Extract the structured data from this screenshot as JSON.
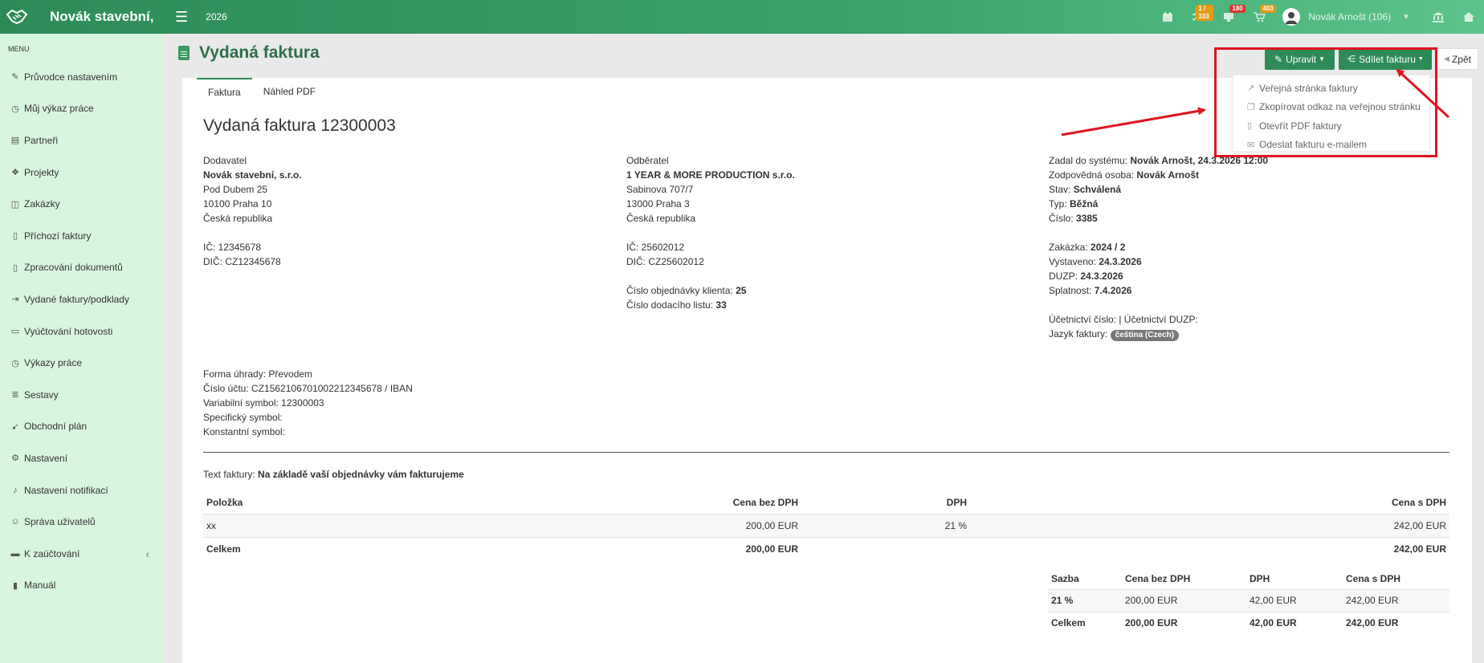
{
  "topbar": {
    "brand": "Novák stavební,",
    "year": "2026",
    "icons": [
      {
        "name": "calendar-icon",
        "badge": "",
        "badge_color": ""
      },
      {
        "name": "tasks-icon",
        "badge": "1 / 333",
        "badge_color": "#e39b1a"
      },
      {
        "name": "notifications-icon",
        "badge": "180",
        "badge_color": "#d9342b"
      },
      {
        "name": "cart-icon",
        "badge": "403",
        "badge_color": "#e39b1a"
      }
    ],
    "user": "Novák Arnošt (106)"
  },
  "sidebar": {
    "label": "MENU",
    "items": [
      {
        "label": "Průvodce nastavením",
        "icon": "wand-icon",
        "glyph": "✎"
      },
      {
        "label": "Můj výkaz práce",
        "icon": "clock-icon",
        "glyph": "◷"
      },
      {
        "label": "Partneři",
        "icon": "building-icon",
        "glyph": "▤"
      },
      {
        "label": "Projekty",
        "icon": "cubes-icon",
        "glyph": "❖"
      },
      {
        "label": "Zakázky",
        "icon": "box-icon",
        "glyph": "◫"
      },
      {
        "label": "Příchozí faktury",
        "icon": "document-icon",
        "glyph": "▯"
      },
      {
        "label": "Zpracování dokumentů",
        "icon": "file-icon",
        "glyph": "▯"
      },
      {
        "label": "Vydané faktury/podklady",
        "icon": "file-export-icon",
        "glyph": "⇥"
      },
      {
        "label": "Vyúčtování hotovosti",
        "icon": "money-icon",
        "glyph": "▭"
      },
      {
        "label": "Výkazy práce",
        "icon": "clock-icon",
        "glyph": "◷"
      },
      {
        "label": "Sestavy",
        "icon": "list-icon",
        "glyph": "≣"
      },
      {
        "label": "Obchodní plán",
        "icon": "rocket-icon",
        "glyph": "➹"
      },
      {
        "label": "Nastavení",
        "icon": "gears-icon",
        "glyph": "⚙"
      },
      {
        "label": "Nastavení notifikací",
        "icon": "bell-icon",
        "glyph": "♪"
      },
      {
        "label": "Správa uživatelů",
        "icon": "users-icon",
        "glyph": "☺"
      },
      {
        "label": "K zaúčtování",
        "icon": "folder-icon",
        "glyph": "▬"
      },
      {
        "label": "Manuál",
        "icon": "book-icon",
        "glyph": "▮"
      }
    ]
  },
  "page": {
    "title": "Vydaná faktura",
    "tabs": [
      "Faktura",
      "Náhled PDF"
    ],
    "invoice_title": "Vydaná faktura 12300003"
  },
  "actions": {
    "edit": "Upravit",
    "share": "Sdílet fakturu",
    "back": "Zpět",
    "share_menu": [
      {
        "label": "Veřejná stránka faktury",
        "icon": "external-link-icon",
        "glyph": "↗"
      },
      {
        "label": "Zkopírovat odkaz na veřejnou stránku",
        "icon": "copy-icon",
        "glyph": "❐"
      },
      {
        "label": "Otevřít PDF faktury",
        "icon": "pdf-icon",
        "glyph": "▯"
      },
      {
        "label": "Odeslat fakturu e-mailem",
        "icon": "envelope-icon",
        "glyph": "✉"
      }
    ]
  },
  "supplier": {
    "heading": "Dodavatel",
    "name": "Novák stavební, s.r.o.",
    "street": "Pod Dubem 25",
    "city": "10100 Praha 10",
    "country": "Česká republika",
    "ic": "IČ: 12345678",
    "dic": "DIČ: CZ12345678"
  },
  "customer": {
    "heading": "Odběratel",
    "name": "1 YEAR & MORE PRODUCTION s.r.o.",
    "street": "Sabinova 707/7",
    "city": "13000 Praha 3",
    "country": "Česká republika",
    "ic": "IČ: 25602012",
    "dic": "DIČ: CZ25602012",
    "order_label": "Číslo objednávky klienta: ",
    "order_value": "25",
    "delivery_label": "Číslo dodacího listu: ",
    "delivery_value": "33"
  },
  "meta": {
    "entered_label": "Zadal do systému: ",
    "entered_value": "Novák Arnošt, 24.3.2026 12:00",
    "responsible_label": "Zodpovědná osoba: ",
    "responsible_value": "Novák Arnošt",
    "state_label": "Stav: ",
    "state_value": "Schválená",
    "type_label": "Typ: ",
    "type_value": "Běžná",
    "number_label": "Číslo: ",
    "number_value": "3385",
    "order_label": "Zakázka: ",
    "order_value": "2024 / 2",
    "issued_label": "Vystaveno: ",
    "issued_value": "24.3.2026",
    "duzp_label": "DUZP: ",
    "duzp_value": "24.3.2026",
    "due_label": "Splatnost: ",
    "due_value": "7.4.2026",
    "accounting": "Účetnictví číslo: | Účetnictví DUZP:",
    "lang_label": "Jazyk faktury: ",
    "lang_value": "čeština (Czech)"
  },
  "payment": {
    "method": "Forma úhrady: Převodem",
    "account": "Číslo účtu: CZ1562106701002212345678 / IBAN",
    "variable": "Variabilní symbol: 12300003",
    "specific": "Specifický symbol:",
    "constant": "Konstantní symbol:"
  },
  "invoice_text": {
    "label": "Text faktury: ",
    "value": "Na základě vaší objednávky vám fakturujeme"
  },
  "items_table": {
    "headers": [
      "Položka",
      "Cena bez DPH",
      "DPH",
      "Cena s DPH"
    ],
    "rows": [
      [
        "xx",
        "200,00 EUR",
        "21 %",
        "242,00 EUR"
      ]
    ],
    "total": [
      "Celkem",
      "200,00 EUR",
      "",
      "242,00 EUR"
    ]
  },
  "rates_table": {
    "headers": [
      "Sazba",
      "Cena bez DPH",
      "DPH",
      "Cena s DPH"
    ],
    "rows": [
      [
        "21 %",
        "200,00 EUR",
        "42,00 EUR",
        "242,00 EUR"
      ]
    ],
    "total": [
      "Celkem",
      "200,00 EUR",
      "42,00 EUR",
      "242,00 EUR"
    ]
  },
  "colors": {
    "brand_green": "#2e8b57",
    "sidebar_bg": "#d8f5de",
    "annotation_red": "#e0141e"
  }
}
